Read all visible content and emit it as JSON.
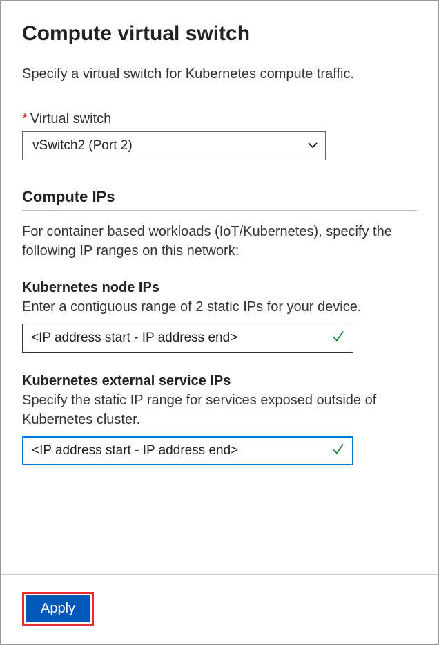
{
  "title": "Compute virtual switch",
  "description": "Specify a virtual switch for Kubernetes compute traffic.",
  "virtualSwitch": {
    "label": "Virtual switch",
    "value": "vSwitch2 (Port 2)"
  },
  "computeIPs": {
    "heading": "Compute IPs",
    "description": "For container based workloads (IoT/Kubernetes), specify the following IP ranges on this network:"
  },
  "nodeIPs": {
    "heading": "Kubernetes node IPs",
    "description": "Enter a contiguous range of 2 static IPs for your device.",
    "value": "<IP address start - IP address end>"
  },
  "serviceIPs": {
    "heading": "Kubernetes external service IPs",
    "description": "Specify the static IP range for services exposed outside of Kubernetes cluster.",
    "value": "<IP address start - IP address end>"
  },
  "footer": {
    "applyLabel": "Apply"
  }
}
